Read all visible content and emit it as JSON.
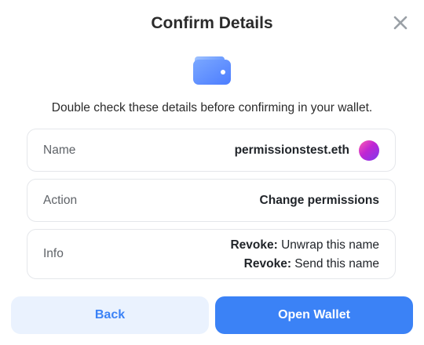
{
  "modal": {
    "title": "Confirm Details",
    "subtitle": "Double check these details before confirming in your wallet."
  },
  "rows": {
    "name": {
      "label": "Name",
      "value": "permissionstest.eth"
    },
    "action": {
      "label": "Action",
      "value": "Change permissions"
    },
    "info": {
      "label": "Info",
      "lines": [
        {
          "prefix": "Revoke:",
          "text": " Unwrap this name"
        },
        {
          "prefix": "Revoke:",
          "text": " Send this name"
        }
      ]
    }
  },
  "buttons": {
    "back": "Back",
    "open_wallet": "Open Wallet"
  },
  "colors": {
    "primary": "#3b82f6",
    "secondary_bg": "#eaf2fe",
    "border": "#e5e7eb",
    "close_icon": "#9aa0a6"
  },
  "icons": {
    "close": "close-icon",
    "wallet": "wallet-icon",
    "avatar": "avatar"
  }
}
